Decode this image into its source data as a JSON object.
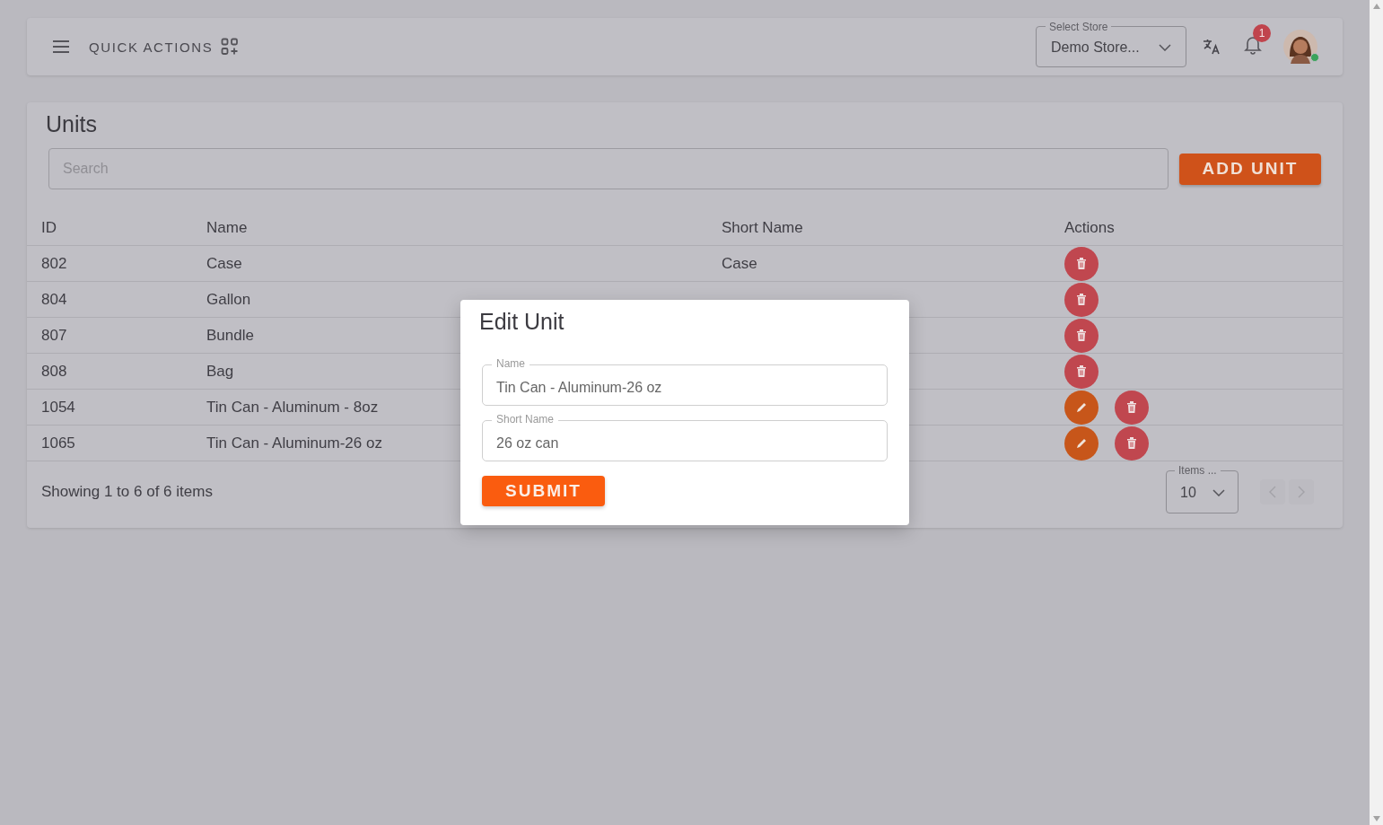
{
  "header": {
    "quick_actions": "QUICK ACTIONS",
    "store_select": {
      "label": "Select Store",
      "value": "Demo Store..."
    },
    "notifications_count": "1"
  },
  "units": {
    "title": "Units",
    "search": {
      "placeholder": "Search"
    },
    "add_button": "ADD UNIT",
    "table": {
      "columns": [
        "ID",
        "Name",
        "Short Name",
        "Actions"
      ],
      "rows": [
        {
          "id": "802",
          "name": "Case",
          "short_name": "Case",
          "editable": false
        },
        {
          "id": "804",
          "name": "Gallon",
          "editable": false
        },
        {
          "id": "807",
          "name": "Bundle",
          "editable": false
        },
        {
          "id": "808",
          "name": "Bag",
          "editable": false
        },
        {
          "id": "1054",
          "name": "Tin Can - Aluminum - 8oz",
          "editable": true
        },
        {
          "id": "1065",
          "name": "Tin Can - Aluminum-26 oz",
          "editable": true
        }
      ]
    },
    "footer": {
      "summary": "Showing 1 to 6 of 6 items",
      "items_per_page": {
        "label": "Items ...",
        "value": "10"
      },
      "previous_disabled": true,
      "next_disabled": true
    }
  },
  "dialog": {
    "title": "Edit Unit",
    "fields": [
      {
        "label": "Name",
        "value": "Tin Can - Aluminum-26 oz"
      },
      {
        "label": "Short Name",
        "value": "26 oz can"
      }
    ],
    "submit": "SUBMIT"
  }
}
